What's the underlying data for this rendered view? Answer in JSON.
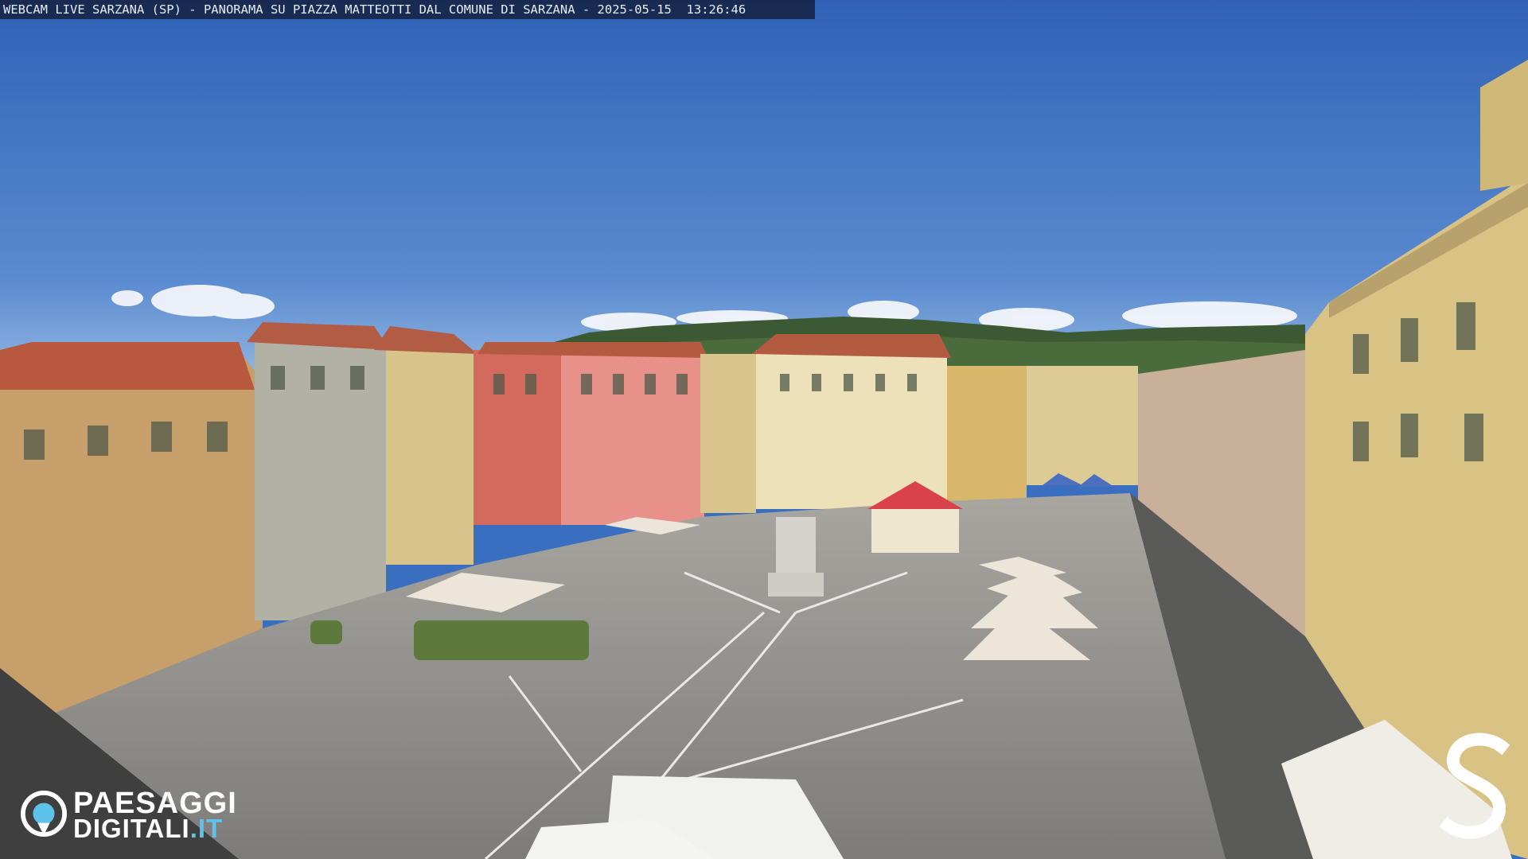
{
  "caption": {
    "text": "WEBCAM LIVE SARZANA (SP) - PANORAMA SU PIAZZA MATTEOTTI DAL COMUNE DI SARZANA - 2025-05-15  13:26:46"
  },
  "logo": {
    "line1": "PAESAGGI",
    "line2_main": "DIGITALI",
    "line2_ext": ".IT",
    "icon": "eye-camera-icon"
  },
  "corner_mark": {
    "icon": "letter-s-mark"
  },
  "colors": {
    "sky": "#3a6fbf",
    "sky_horizon": "#7fa8d8",
    "pavement": "#8a8a88",
    "ext_accent": "#5fc2ea"
  }
}
